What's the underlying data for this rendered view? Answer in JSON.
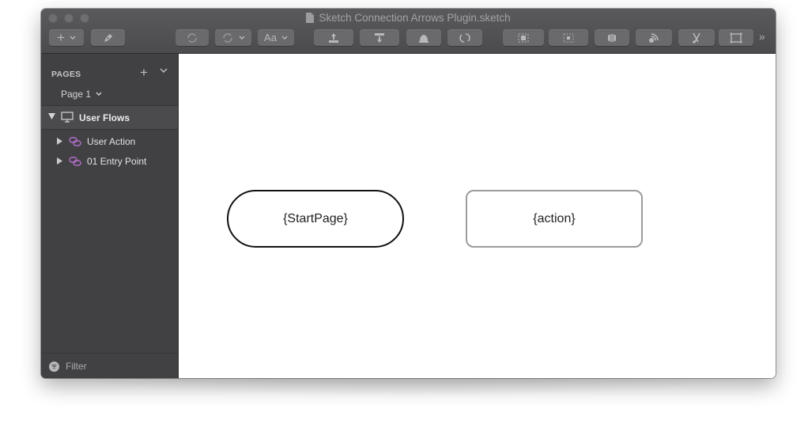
{
  "window": {
    "title": "Sketch Connection Arrows Plugin.sketch",
    "traffic_lights": [
      "close-button",
      "minimize-button",
      "zoom-button"
    ]
  },
  "toolbar": {
    "insert_symbol": "+",
    "font_label": "Aa",
    "more_symbol": "»",
    "items": [
      "insert-icon",
      "pen-icon",
      "rotate-icon",
      "flip-icon",
      "text-style-icon",
      "upload-icon",
      "download-icon",
      "bell-icon",
      "refresh-icon",
      "group-icon",
      "ungroup-icon",
      "mask-icon",
      "layers-icon",
      "scissors-icon",
      "artboard-icon"
    ]
  },
  "sidebar": {
    "pages_label": "PAGES",
    "add_symbol": "+",
    "current_page": "Page 1",
    "group": {
      "label": "User Flows",
      "icon": "monitor-icon"
    },
    "layers": [
      {
        "label": "User Action",
        "icon": "link-icon"
      },
      {
        "label": "01 Entry Point",
        "icon": "link-icon"
      }
    ],
    "filter_label": "Filter"
  },
  "canvas": {
    "shapes": [
      {
        "label": "{StartPage}",
        "style": "rounded-pill",
        "border_color": "#111111"
      },
      {
        "label": "{action}",
        "style": "rounded-rect",
        "border_color": "#9b9b9b"
      }
    ]
  },
  "colors": {
    "titlebar": "#4e4e50",
    "sidebar": "#414143",
    "selected_row": "#4b4b4d",
    "link_icon": "#b06ec9",
    "canvas": "#ffffff"
  }
}
